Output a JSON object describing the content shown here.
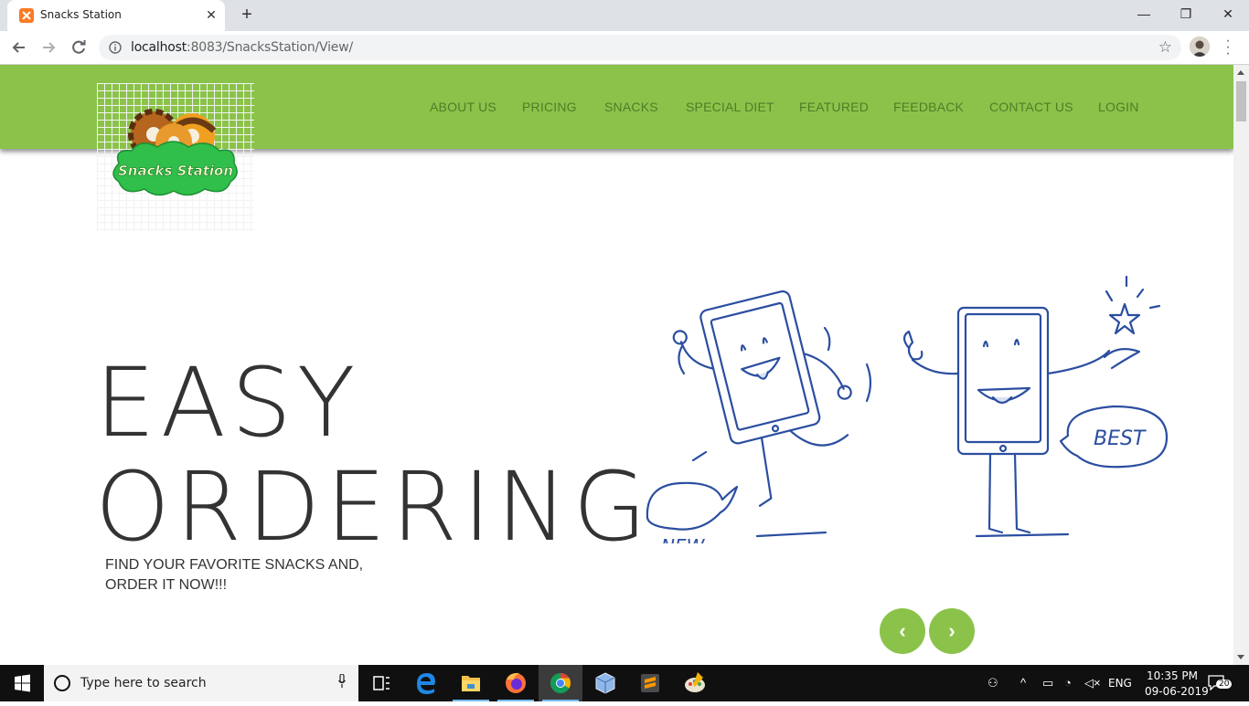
{
  "browser": {
    "tab_title": "Snacks Station",
    "tab_close": "✕",
    "new_tab": "+",
    "url_host": "localhost",
    "url_rest": ":8083/SnacksStation/View/",
    "window_controls": {
      "minimize": "—",
      "maximize": "❐",
      "close": "✕"
    }
  },
  "navbar": {
    "links": [
      "ABOUT US",
      "PRICING",
      "SNACKS",
      "SPECIAL DIET",
      "FEATURED",
      "FEEDBACK",
      "CONTACT US",
      "LOGIN"
    ],
    "logo_text": "Snacks Station",
    "color": "#8bc34a"
  },
  "hero": {
    "line1": "EASY",
    "line2": "ORDERING",
    "sub_line1": "FIND YOUR FAVORITE SNACKS AND,",
    "sub_line2": "ORDER IT NOW!!!",
    "bubble_left": "NEW",
    "bubble_right": "BEST",
    "prev_label": "‹",
    "next_label": "›"
  },
  "taskbar": {
    "search_placeholder": "Type here to search",
    "language": "ENG",
    "time": "10:35 PM",
    "date": "09-06-2019",
    "notification_count": "20"
  }
}
